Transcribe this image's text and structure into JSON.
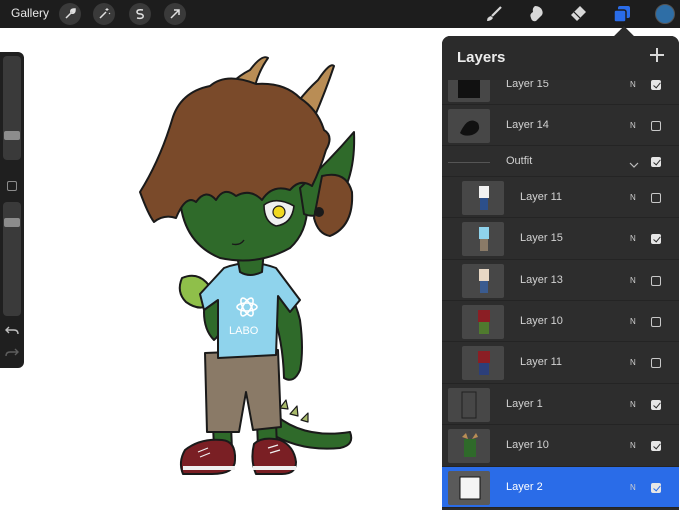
{
  "topbar": {
    "gallery_label": "Gallery",
    "left_tools": [
      "wrench-icon",
      "magic-wand-icon",
      "selection-icon",
      "transform-arrow-icon"
    ],
    "right_tools": [
      "brush-icon",
      "smudge-icon",
      "eraser-icon",
      "layers-icon"
    ],
    "active_tool": "layers-icon",
    "current_color": "#2e6ea6"
  },
  "sidebar": {
    "brush_size_level": 0.45,
    "opacity_level": 0.85,
    "controls": [
      "brush-size-slider",
      "modify-button",
      "opacity-slider",
      "undo-icon",
      "redo-icon"
    ]
  },
  "layers_panel": {
    "title": "Layers",
    "add_label": "+",
    "layers": [
      {
        "name": "Layer 15",
        "blend": "N",
        "visible": true,
        "selected": false,
        "indented": false
      },
      {
        "name": "Layer 14",
        "blend": "N",
        "visible": false,
        "selected": false,
        "indented": false
      },
      {
        "name": "Outfit",
        "blend": "",
        "visible": true,
        "selected": false,
        "indented": false,
        "group": true
      },
      {
        "name": "Layer 11",
        "blend": "N",
        "visible": false,
        "selected": false,
        "indented": true
      },
      {
        "name": "Layer 15",
        "blend": "N",
        "visible": true,
        "selected": false,
        "indented": true
      },
      {
        "name": "Layer 13",
        "blend": "N",
        "visible": false,
        "selected": false,
        "indented": true
      },
      {
        "name": "Layer 10",
        "blend": "N",
        "visible": false,
        "selected": false,
        "indented": true
      },
      {
        "name": "Layer 11",
        "blend": "N",
        "visible": false,
        "selected": false,
        "indented": true
      },
      {
        "name": "Layer 1",
        "blend": "N",
        "visible": true,
        "selected": false,
        "indented": false
      },
      {
        "name": "Layer 10",
        "blend": "N",
        "visible": true,
        "selected": false,
        "indented": false
      },
      {
        "name": "Layer 2",
        "blend": "N",
        "visible": true,
        "selected": true,
        "indented": false
      }
    ]
  },
  "canvas": {
    "shirt_text": "LABO",
    "colors": {
      "skin": "#2f6a2a",
      "hair": "#7a4a2a",
      "horn": "#b98d55",
      "shirt": "#8fd3ec",
      "shorts": "#8a7a67",
      "shoes": "#7a1f24",
      "eye": "#f0d820",
      "selected_layer": "#2a6ce8"
    }
  }
}
